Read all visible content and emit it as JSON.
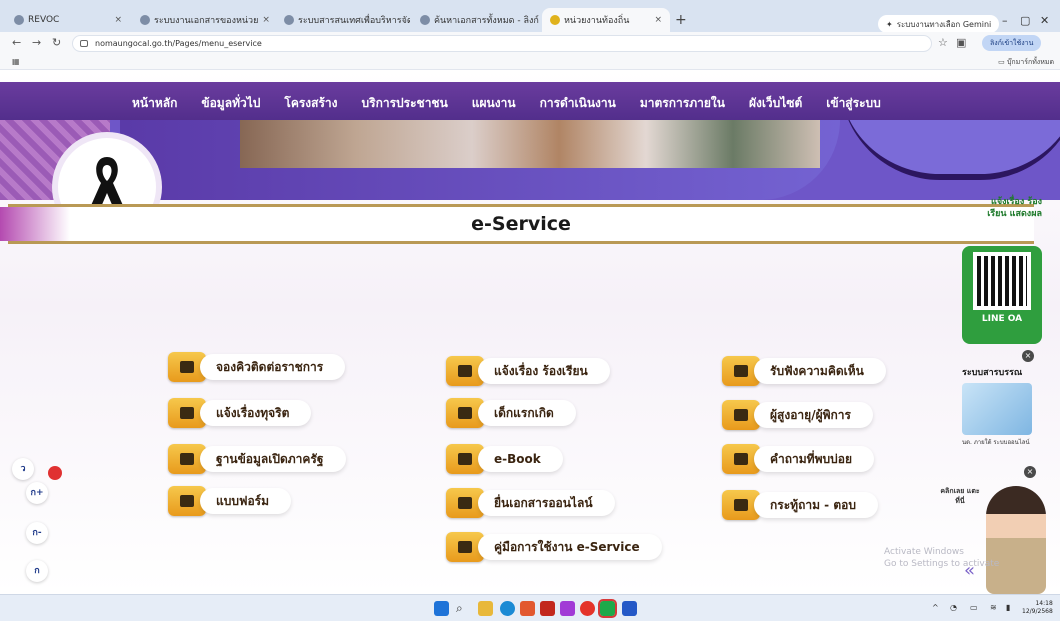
{
  "browser": {
    "tabs": [
      {
        "title": "REVOC"
      },
      {
        "title": "ระบบงานเอกสารของหน่วย"
      },
      {
        "title": "ระบบสารสนเทศเพื่อบริหารจัดการข้อมูลท้องถิ่น"
      },
      {
        "title": "ค้นหาเอกสารทั้งหมด - ลิงก์ ก็ออนไลน์"
      },
      {
        "title": "หน่วยงานท้องถิ่น"
      }
    ],
    "gemini_button": "ระบบงานทางเลือก Gemini",
    "url": "nomaungocal.go.th/Pages/menu_eservice",
    "signin_button": "ลิงก์เข้าใช้งาน",
    "bookmarks_folder": "บุ๊กมาร์กทั้งหมด"
  },
  "nav": {
    "items": [
      "หน้าหลัก",
      "ข้อมูลทั่วไป",
      "โครงสร้าง",
      "บริการประชาชน",
      "แผนงาน",
      "การดำเนินงาน",
      "มาตรการภายใน",
      "ผังเว็บไซต์",
      "เข้าสู่ระบบ"
    ]
  },
  "page_title": "e-Service",
  "services": {
    "col1": [
      "จองคิวติดต่อราชการ",
      "แจ้งเรื่องทุจริต",
      "ฐานข้อมูลเปิดภาครัฐ",
      "แบบฟอร์ม"
    ],
    "col2": [
      "แจ้งเรื่อง ร้องเรียน",
      "เด็กแรกเกิด",
      "e-Book",
      "ยื่นเอกสารออนไลน์",
      "คู่มือการใช้งาน e-Service"
    ],
    "col3": [
      "รับฟังความคิดเห็น",
      "ผู้สูงอายุ/ผู้พิการ",
      "คำถามที่พบบ่อย",
      "กระทู้ถาม - ตอบ"
    ]
  },
  "line_oa": {
    "heading": "แจ้งเรื่อง ร้องเรียน แสดงผล",
    "label": "LINE OA"
  },
  "survey": {
    "title": "ระบบสารบรรณ",
    "subtitle": "นด. ภายใต้ ระบบออนไลน์"
  },
  "helper": {
    "bubble": "คลิกเลย แตะที่นี่"
  },
  "activate_windows": {
    "line1": "Activate Windows",
    "line2": "Go to Settings to activate"
  },
  "font_size_controls": {
    "minus": "ก-",
    "plus": "ก+",
    "reset": "ก",
    "contrast": "ว"
  },
  "taskbar": {
    "time": "14:18",
    "date": "12/9/2568"
  },
  "colors": {
    "nav_purple": "#4b2a86",
    "button_orange": "#e89a1c",
    "title_gold": "#b99955",
    "line_green": "#2f9e3e"
  }
}
